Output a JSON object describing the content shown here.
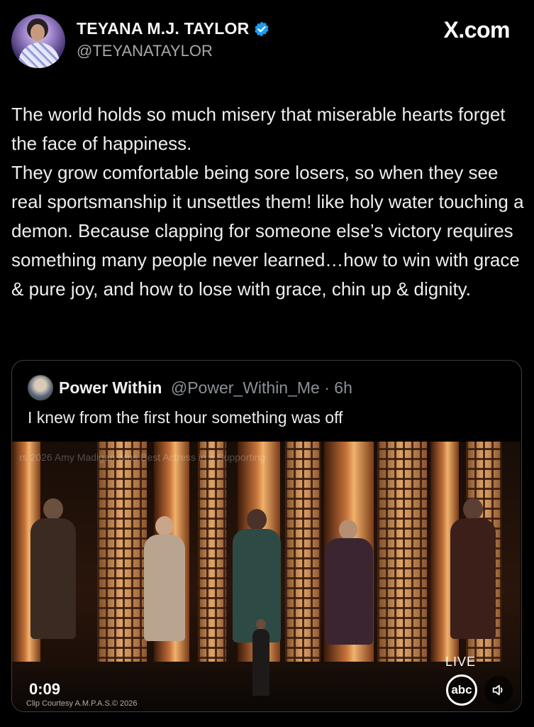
{
  "header": {
    "display_name": "TEYANA M.J. TAYLOR",
    "handle": "@TEYANATAYLOR",
    "site": "X.com",
    "verified_color": "#1d9bf0"
  },
  "tweet": {
    "paragraph1": "The world holds so much misery that miserable hearts forget the face of happiness.",
    "paragraph2": "They grow comfortable being sore losers, so when they see real sportsmanship it unsettles them! like holy water touching a demon. Because clapping for someone else’s victory requires something many people never learned…how to win with grace & pure joy, and how to lose with grace, chin up & dignity."
  },
  "quote": {
    "name": "Power Within",
    "handle_time": "@Power_Within_Me · 6h",
    "text": "I knew from the first hour something was off",
    "video": {
      "overlay_title": "rs 2026 Amy Madigan wins Best Actress in a Supporting",
      "time": "0:09",
      "courtesy": "Clip Courtesy A.M.P.A.S.© 2026",
      "live": "LIVE",
      "network": "abc"
    }
  }
}
